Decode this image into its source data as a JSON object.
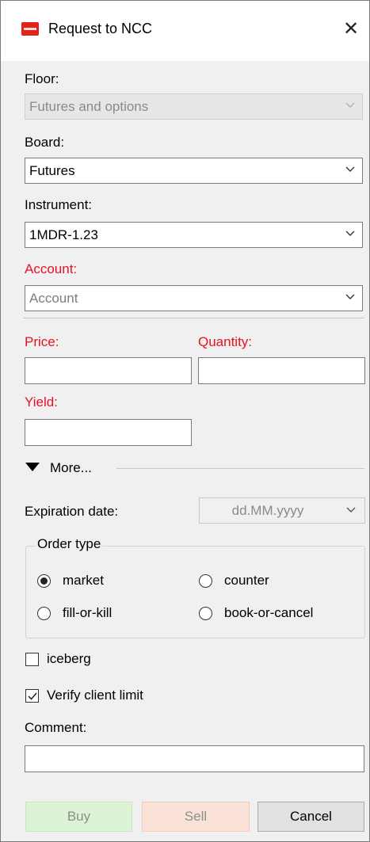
{
  "window": {
    "title": "Request to NCC",
    "close_glyph": "✕",
    "app_icon": "moex-logo-icon"
  },
  "form": {
    "floor": {
      "label": "Floor:",
      "value": "Futures and options"
    },
    "board": {
      "label": "Board:",
      "value": "Futures"
    },
    "instrument": {
      "label": "Instrument:",
      "value": "1MDR-1.23"
    },
    "account": {
      "label": "Account:",
      "placeholder": "Account",
      "label_color": "#e81123"
    },
    "price": {
      "label": "Price:",
      "value": ""
    },
    "quantity": {
      "label": "Quantity:",
      "value": ""
    },
    "yield": {
      "label": "Yield:",
      "value": ""
    },
    "more": {
      "label": "More..."
    },
    "expiration": {
      "label": "Expiration date:",
      "placeholder": "dd.MM.yyyy"
    },
    "order_type": {
      "title": "Order type",
      "options": [
        {
          "label": "market",
          "checked": true
        },
        {
          "label": "counter",
          "checked": false
        },
        {
          "label": "fill-or-kill",
          "checked": false
        },
        {
          "label": "book-or-cancel",
          "checked": false
        }
      ]
    },
    "iceberg": {
      "label": "iceberg",
      "checked": false
    },
    "verify_limit": {
      "label": "Verify client limit",
      "checked": true
    },
    "comment": {
      "label": "Comment:",
      "value": ""
    }
  },
  "buttons": {
    "buy": "Buy",
    "sell": "Sell",
    "cancel": "Cancel"
  },
  "colors": {
    "buy_bg": "#dcf3d6",
    "sell_bg": "#fbe2d6",
    "cancel_bg": "#e1e1e1",
    "required": "#e81123"
  }
}
